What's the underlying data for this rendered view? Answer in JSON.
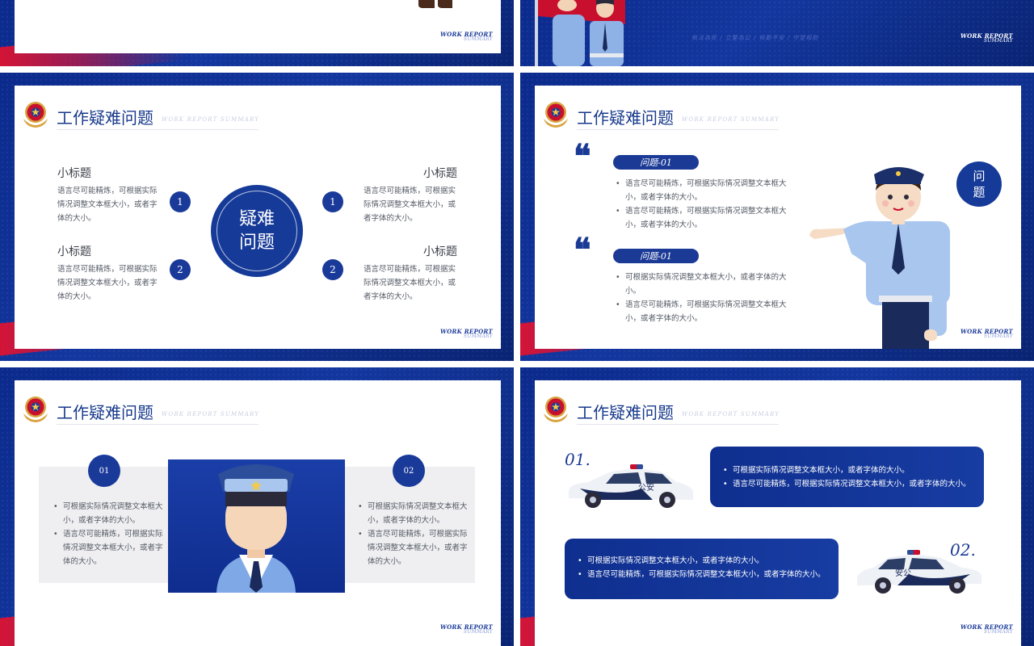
{
  "slides": {
    "s1": {
      "wr_a": "WORK REPORT",
      "wr_b": "SUMMARY"
    },
    "s2": {
      "slogan": "執法為民 / 立警為公 / 執勤平安 / 守望相助",
      "wr_a": "WORK REPORT",
      "wr_b": "SUMMARY"
    },
    "s3": {
      "title": "工作疑难问题",
      "subtitle": "WORK REPORT SUMMARY",
      "center_line1": "疑难",
      "center_line2": "问题",
      "items": [
        {
          "heading": "小标题",
          "num": "1",
          "text": "语言尽可能精炼，可根据实际情况调整文本框大小，或者字体的大小。"
        },
        {
          "heading": "小标题",
          "num": "2",
          "text": "语言尽可能精炼，可根据实际情况调整文本框大小，或者字体的大小。"
        },
        {
          "heading": "小标题",
          "num": "1",
          "text": "语言尽可能精炼，可根据实际情况调整文本框大小，或者字体的大小。"
        },
        {
          "heading": "小标题",
          "num": "2",
          "text": "语言尽可能精炼，可根据实际情况调整文本框大小，或者字体的大小。"
        }
      ],
      "wr_a": "WORK REPORT",
      "wr_b": "SUMMARY"
    },
    "s4": {
      "title": "工作疑难问题",
      "subtitle": "WORK REPORT SUMMARY",
      "badge_line1": "问",
      "badge_line2": "题",
      "blocks": [
        {
          "label": "问题-01",
          "bullets": [
            "语言尽可能精炼，可根据实际情况调整文本框大小，或者字体的大小。",
            "语言尽可能精炼，可根据实际情况调整文本框大小，或者字体的大小。"
          ]
        },
        {
          "label": "问题-01",
          "bullets": [
            "可根据实际情况调整文本框大小，或者字体的大小。",
            "语言尽可能精炼，可根据实际情况调整文本框大小，或者字体的大小。"
          ]
        }
      ],
      "wr_a": "WORK REPORT",
      "wr_b": "SUMMARY"
    },
    "s5": {
      "title": "工作疑难问题",
      "subtitle": "WORK REPORT SUMMARY",
      "cols": [
        {
          "num": "01",
          "bullets": [
            "可根据实际情况调整文本框大小，或者字体的大小。",
            "语言尽可能精炼，可根据实际情况调整文本框大小，或者字体的大小。"
          ]
        },
        {
          "num": "02",
          "bullets": [
            "可根据实际情况调整文本框大小，或者字体的大小。",
            "语言尽可能精炼，可根据实际情况调整文本框大小，或者字体的大小。"
          ]
        }
      ],
      "wr_a": "WORK REPORT",
      "wr_b": "SUMMARY"
    },
    "s6": {
      "title": "工作疑难问题",
      "subtitle": "WORK REPORT SUMMARY",
      "rows": [
        {
          "num": "01.",
          "car_text": "公安",
          "bullets": [
            "可根据实际情况调整文本框大小，或者字体的大小。",
            "语言尽可能精炼，可根据实际情况调整文本框大小，或者字体的大小。"
          ]
        },
        {
          "num": "02.",
          "car_text": "安公",
          "bullets": [
            "可根据实际情况调整文本框大小，或者字体的大小。",
            "语言尽可能精炼，可根据实际情况调整文本框大小，或者字体的大小。"
          ]
        }
      ],
      "wr_a": "WORK REPORT",
      "wr_b": "SUMMARY"
    }
  },
  "colors": {
    "primary": "#1a3a9a",
    "red": "#e8112d",
    "bg": "#0b2a8c"
  }
}
